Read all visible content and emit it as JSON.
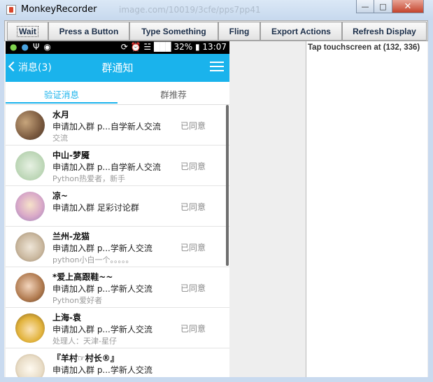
{
  "window": {
    "title": "MonkeyRecorder",
    "title_ghost": "image.com/10019/3cfe/pps7pp41",
    "controls": [
      "minimize-icon",
      "maximize-icon",
      "close-icon"
    ]
  },
  "toolbar": {
    "wait": "Wait",
    "press": "Press a Button",
    "type": "Type Something",
    "fling": "Fling",
    "export": "Export Actions",
    "refresh": "Refresh Display"
  },
  "log": {
    "line1": "Tap touchscreen at (132, 336)"
  },
  "phone": {
    "statusbar": {
      "left_icons": [
        "360-icon",
        "globe-icon",
        "usb-icon",
        "android-icon"
      ],
      "right": "⊚ ⏰ ◥ ❙❙❙ 32% ▮ 13:07",
      "battery": "32%",
      "time": "13:07"
    },
    "appbar": {
      "back_label": "消息(3)",
      "title": "群通知",
      "menu_icon": "hamburger-icon"
    },
    "tabs": [
      {
        "label": "验证消息"
      },
      {
        "label": "群推荐"
      }
    ],
    "accent": "#1ab3ec",
    "items": [
      {
        "name": "水月",
        "request": "申请加入群 p...自学新人交流",
        "note": "交流",
        "status": "已同意"
      },
      {
        "name": "中山-梦魇",
        "request": "申请加入群 p...自学新人交流",
        "note": "Python热爱者，新手",
        "status": "已同意"
      },
      {
        "name": "凉~",
        "request": "申请加入群 足彩讨论群",
        "note": "",
        "status": "已同意"
      },
      {
        "name": "兰州-龙猫",
        "request": "申请加入群 p...学新人交流",
        "note": "python小白一个。。。。。",
        "status": "已同意"
      },
      {
        "name": "*爱上高跟鞋~~",
        "request": "申请加入群 p...学新人交流",
        "note": "Python爱好者",
        "status": "已同意"
      },
      {
        "name": "上海-袁",
        "request": "申请加入群 p...学新人交流",
        "note": "处理人：天津-星仔",
        "status": "已同意"
      },
      {
        "name": "『羊村☞村长®』",
        "request": "申请加入群 p...学新人交流",
        "note": "",
        "status": ""
      }
    ]
  }
}
